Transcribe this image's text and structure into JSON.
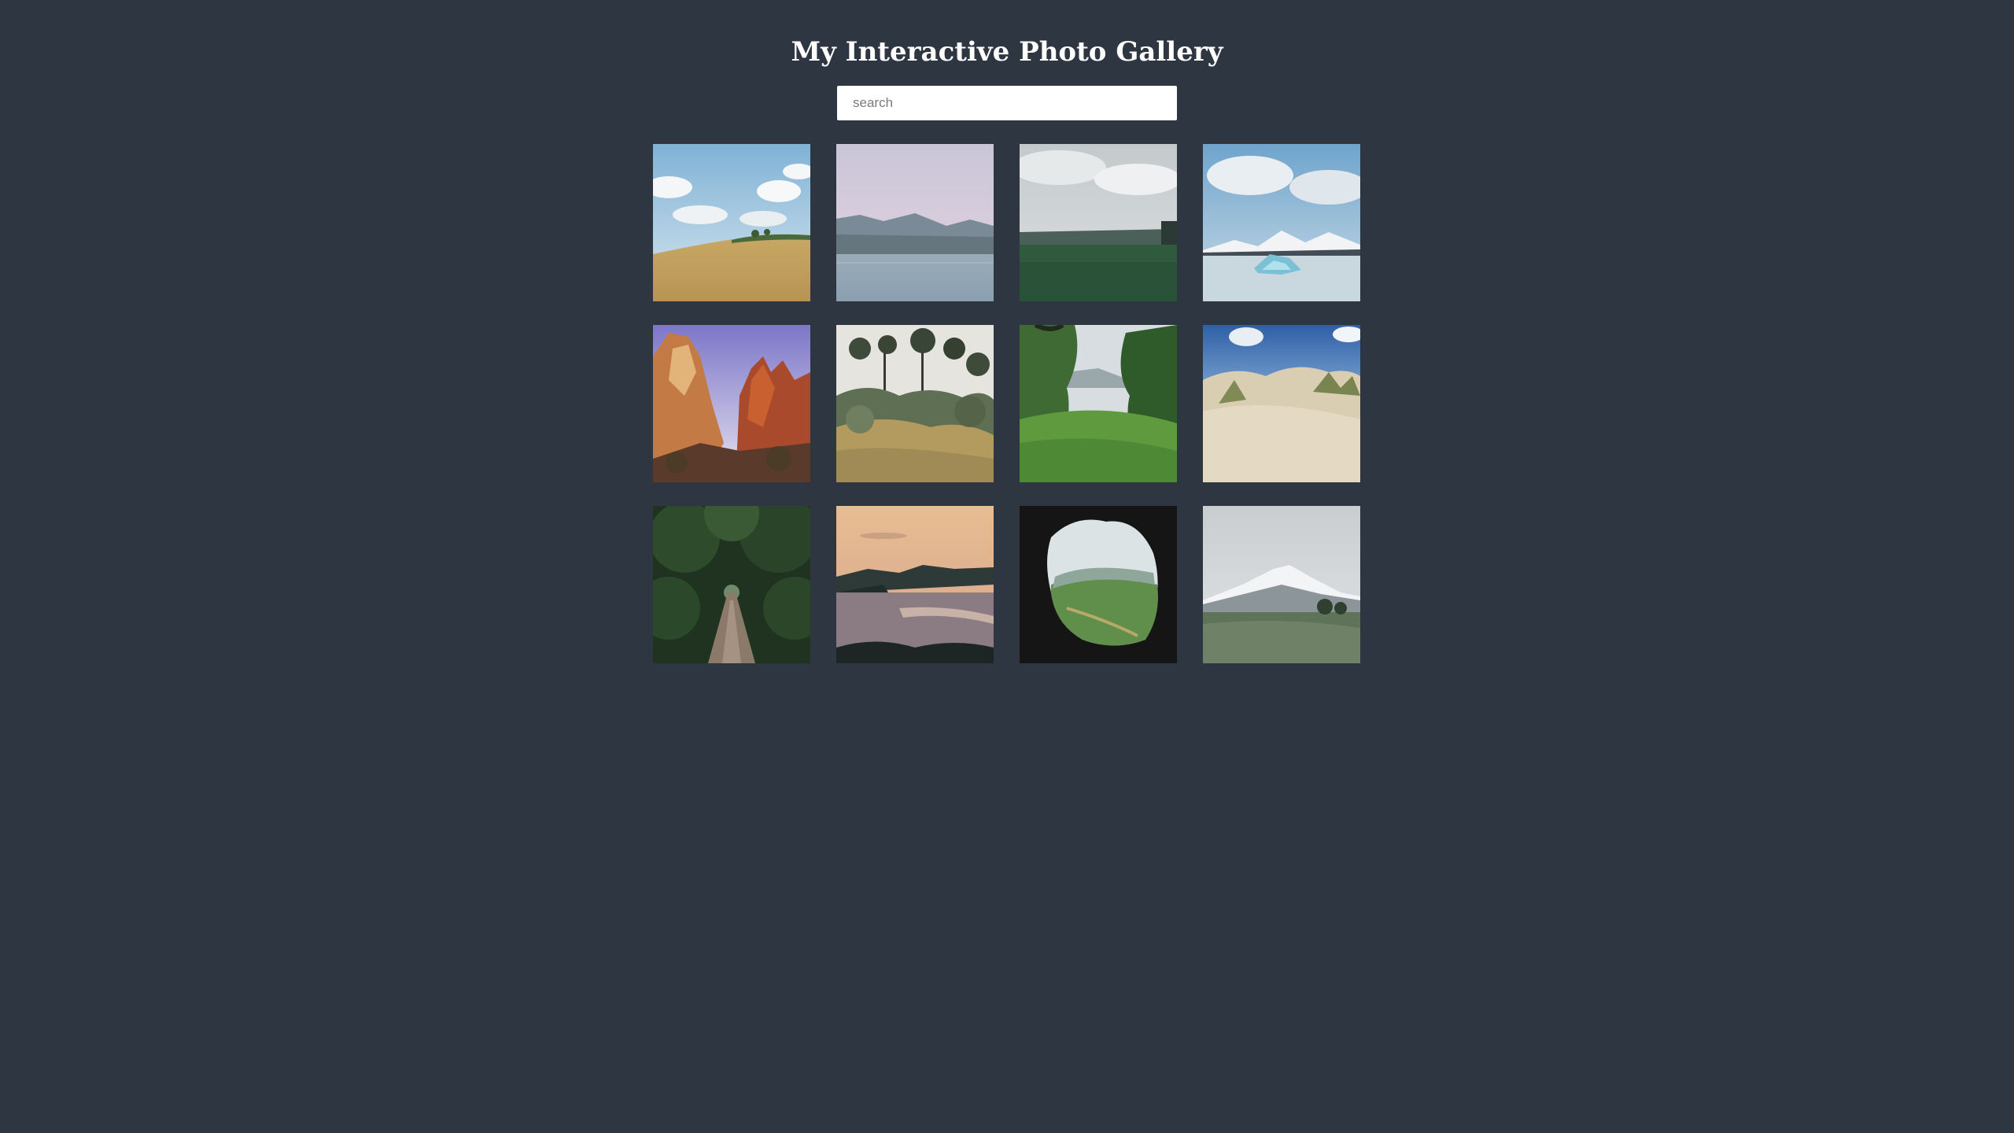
{
  "header": {
    "title": "My Interactive Photo Gallery"
  },
  "search": {
    "placeholder": "search",
    "value": ""
  },
  "colors": {
    "background": "#2e3641",
    "title": "#ffffff",
    "search_bg": "#ffffff"
  },
  "gallery": {
    "photos": [
      {
        "name": "photo-hillside-field",
        "subject": "hillside-field"
      },
      {
        "name": "photo-mountain-lake",
        "subject": "mountain-lake"
      },
      {
        "name": "photo-green-meadow",
        "subject": "green-meadow"
      },
      {
        "name": "photo-glacier-lagoon",
        "subject": "glacier-lagoon"
      },
      {
        "name": "photo-red-canyon",
        "subject": "red-canyon"
      },
      {
        "name": "photo-garden-shrubs",
        "subject": "garden-shrubs"
      },
      {
        "name": "photo-forest-valley",
        "subject": "forest-valley"
      },
      {
        "name": "photo-sand-dunes",
        "subject": "sand-dunes"
      },
      {
        "name": "photo-tree-tunnel-path",
        "subject": "tree-tunnel-path"
      },
      {
        "name": "photo-coastal-sunset",
        "subject": "coastal-sunset"
      },
      {
        "name": "photo-cave-opening-valley",
        "subject": "cave-opening-valley"
      },
      {
        "name": "photo-snowy-mountain-meadow",
        "subject": "snowy-mountain-meadow"
      }
    ]
  }
}
